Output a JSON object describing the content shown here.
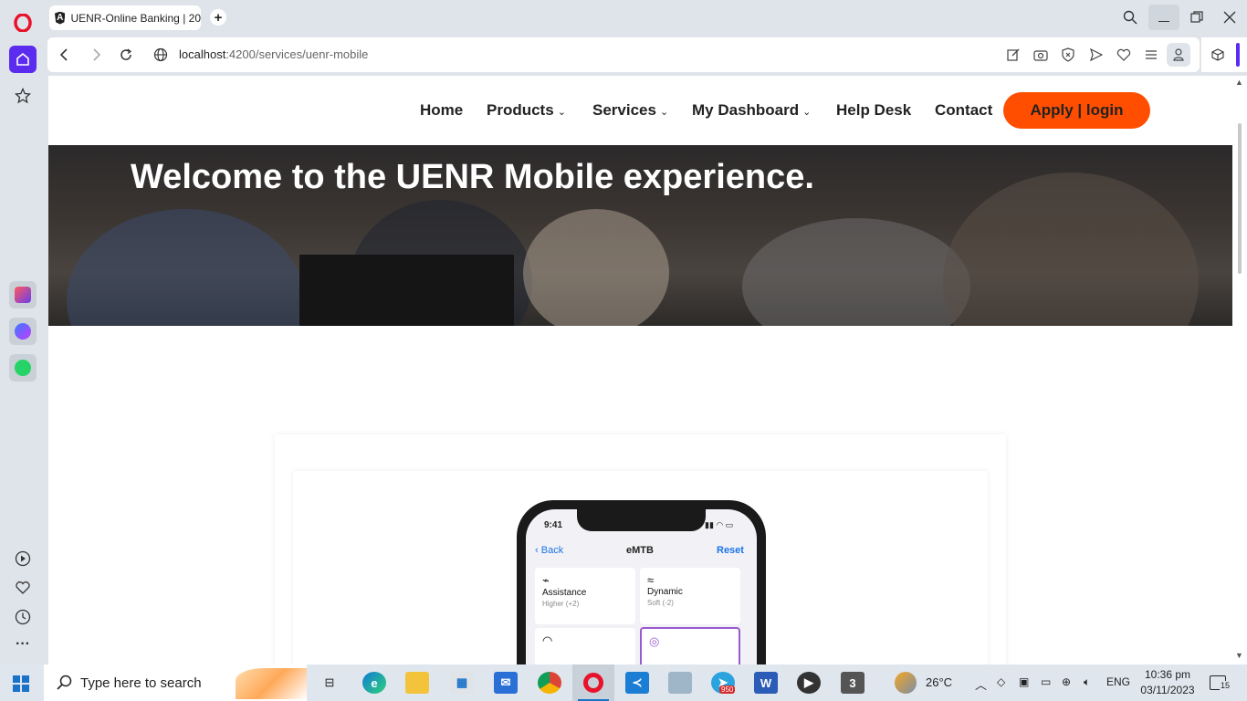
{
  "browser": {
    "tab_title": "UENR-Online Banking | 20",
    "url_host": "localhost",
    "url_path": ":4200/services/uenr-mobile"
  },
  "site": {
    "nav": {
      "home": "Home",
      "products": "Products",
      "services": "Services",
      "dashboard": "My Dashboard",
      "help": "Help Desk",
      "contact": "Contact",
      "apply_login": "Apply | login"
    },
    "hero_title": "Welcome to the UENR Mobile experience.",
    "phone": {
      "time": "9:41",
      "back": "Back",
      "title": "eMTB",
      "reset": "Reset",
      "cards": [
        {
          "label": "Assistance",
          "sub": "Higher (+2)"
        },
        {
          "label": "Dynamic",
          "sub": "Soft (-2)"
        }
      ]
    }
  },
  "taskbar": {
    "search_placeholder": "Type here to search",
    "weather": "26°C",
    "language": "ENG",
    "time": "10:36 pm",
    "date": "03/11/2023",
    "telegram_badge": "950",
    "notifications": "15"
  },
  "colors": {
    "accent": "#ff4e00",
    "opera_red": "#e8132b",
    "sidebar_home": "#5b2bf0"
  }
}
